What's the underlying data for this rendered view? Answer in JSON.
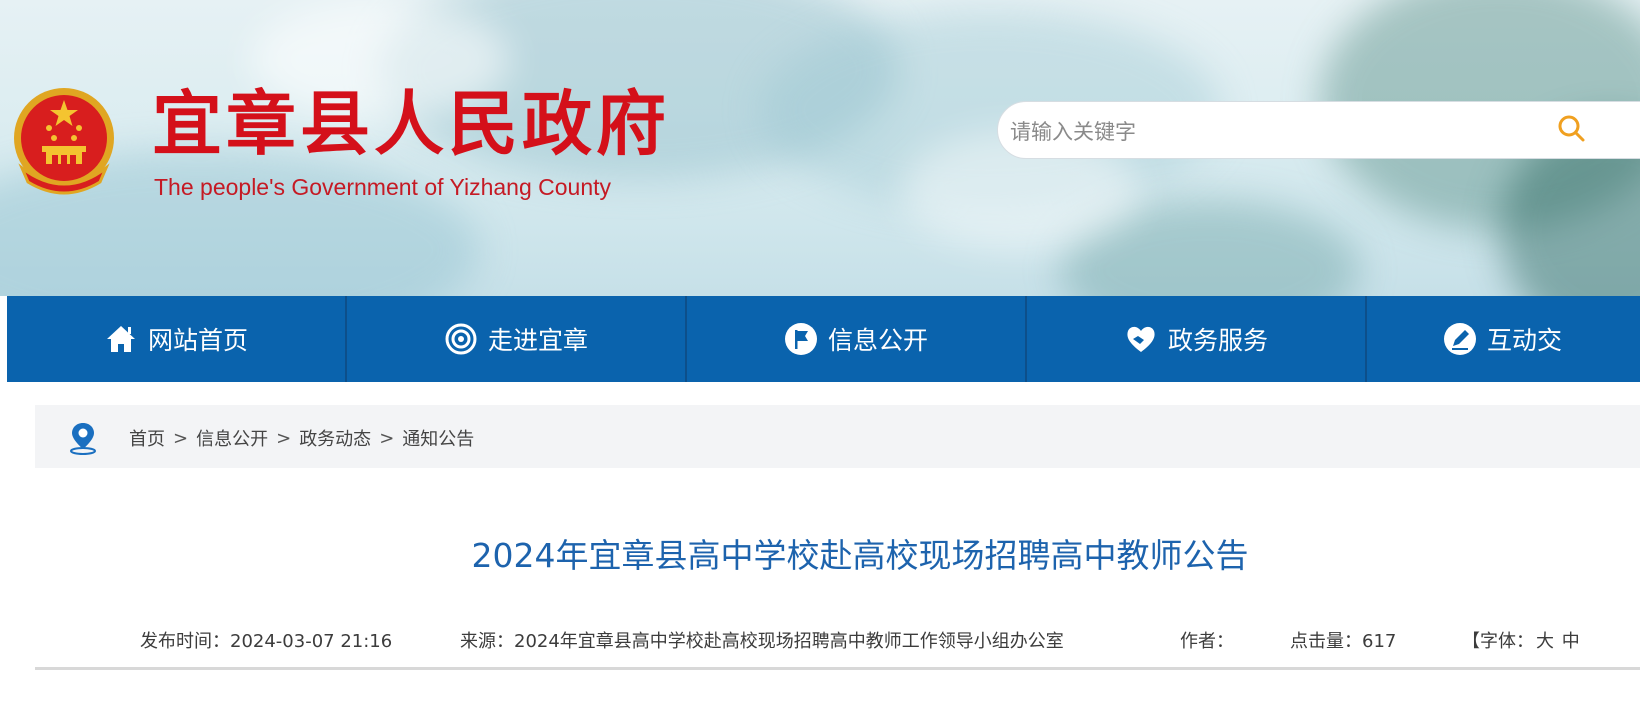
{
  "header": {
    "site_title": "宜章县人民政府",
    "site_subtitle": "The people's Government of Yizhang County",
    "emblem_icon": "national-emblem-icon",
    "search": {
      "placeholder": "请输入关键字",
      "value": "",
      "icon": "search-icon"
    }
  },
  "nav": {
    "items": [
      {
        "label": "网站首页",
        "icon": "home-icon"
      },
      {
        "label": "走进宜章",
        "icon": "target-icon"
      },
      {
        "label": "信息公开",
        "icon": "flag-icon"
      },
      {
        "label": "政务服务",
        "icon": "heart-hand-icon"
      },
      {
        "label": "互动交",
        "icon": "pen-icon"
      }
    ]
  },
  "breadcrumb": {
    "icon": "location-pin-icon",
    "items": [
      "首页",
      "信息公开",
      "政务动态",
      "通知公告"
    ],
    "separator": ">"
  },
  "article": {
    "title": "2024年宜章县高中学校赴高校现场招聘高中教师公告",
    "publish_time": "发布时间：2024-03-07 21:16",
    "source": "来源：2024年宜章县高中学校赴高校现场招聘高中教师工作领导小组办公室",
    "author": "作者：",
    "hits": "点击量：617",
    "font_label": "【字体：",
    "font_options": [
      "大",
      "中"
    ]
  },
  "colors": {
    "brand_red": "#d4101a",
    "nav_blue": "#0a63ad",
    "title_blue": "#1d63ad",
    "breadcrumb_bg": "#f3f4f6"
  }
}
